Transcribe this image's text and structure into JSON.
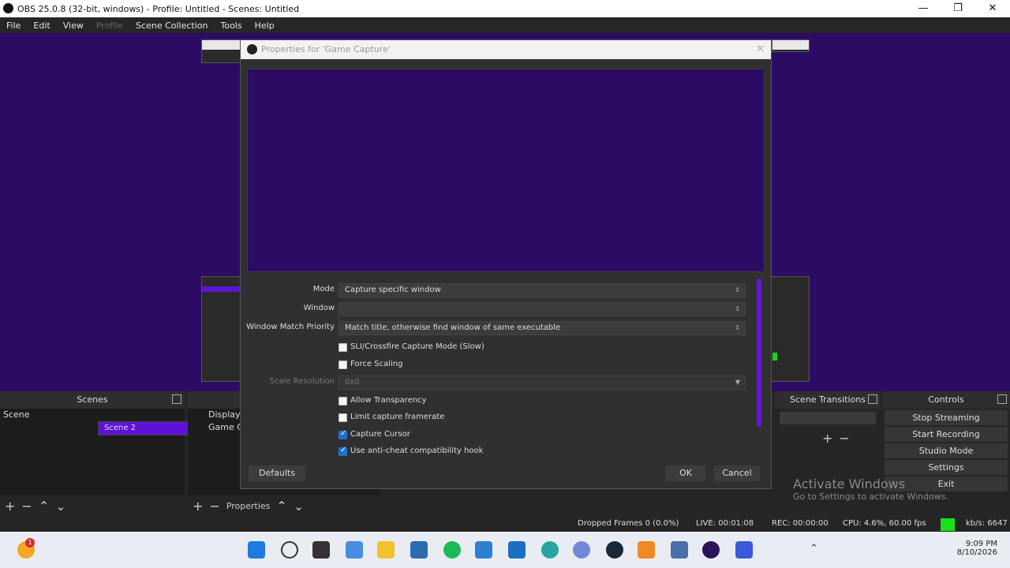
{
  "app": {
    "title": "OBS 25.0.8 (32-bit, windows) - Profile: Untitled - Scenes: Untitled",
    "window_controls": [
      "—",
      "❐",
      "✕"
    ]
  },
  "menu": [
    "File",
    "Edit",
    "View",
    "Profile",
    "Scene Collection",
    "Tools",
    "Help"
  ],
  "dialog": {
    "title": "Properties for 'Game Capture'",
    "mode_label": "Mode",
    "mode_value": "Capture specific window",
    "window_label": "Window",
    "window_value": "",
    "priority_label": "Window Match Priority",
    "priority_value": "Match title, otherwise find window of same executable",
    "sli_label": "SLI/Crossfire Capture Mode (Slow)",
    "force_scaling_label": "Force Scaling",
    "scale_res_label": "Scale Resolution",
    "scale_res_value": "0x0",
    "allow_transparency_label": "Allow Transparency",
    "limit_framerate_label": "Limit capture framerate",
    "capture_cursor_label": "Capture Cursor",
    "anticheat_label": "Use anti-cheat compatibility hook",
    "checkboxes": {
      "sli": false,
      "force_scaling": false,
      "allow_transparency": false,
      "limit_framerate": false,
      "capture_cursor": true,
      "anticheat": true
    },
    "defaults_button": "Defaults",
    "ok_button": "OK",
    "cancel_button": "Cancel"
  },
  "scenes": {
    "header": "Scenes",
    "items": [
      "Scene",
      "Scene 2"
    ],
    "selected": "Scene 2"
  },
  "sources": {
    "items": [
      "Display C",
      "Game Ca"
    ],
    "properties_label": "Properties"
  },
  "transitions": {
    "header": "Scene Transitions"
  },
  "controls": {
    "header": "Controls",
    "buttons": [
      "Stop Streaming",
      "Start Recording",
      "Studio Mode",
      "Settings",
      "Exit"
    ]
  },
  "status": {
    "dropped": "Dropped Frames 0 (0.0%)",
    "live": "LIVE: 00:01:08",
    "rec": "REC: 00:00:00",
    "cpu": "CPU: 4.6%, 60.00 fps",
    "kbps": "kb/s: 6647"
  },
  "watermark": {
    "line1": "Activate Windows",
    "line2": "Go to Settings to activate Windows."
  },
  "taskbar": {
    "time": "9:09 PM",
    "date": "8/10/2026",
    "badge": "1"
  },
  "colors": {
    "accent": "#5e12d6",
    "preview_bg": "#2b0b63",
    "checkbox_on": "#1f6fd1"
  }
}
